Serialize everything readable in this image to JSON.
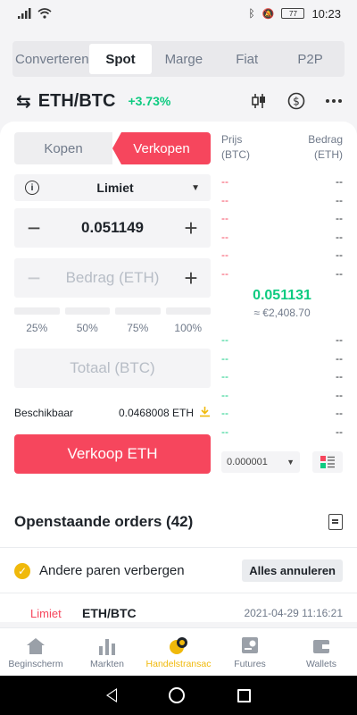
{
  "status_bar": {
    "time": "10:23",
    "battery": "77"
  },
  "top_tabs": [
    {
      "label": "Converteren",
      "active": false
    },
    {
      "label": "Spot",
      "active": true
    },
    {
      "label": "Marge",
      "active": false
    },
    {
      "label": "Fiat",
      "active": false
    },
    {
      "label": "P2P",
      "active": false
    }
  ],
  "pair": {
    "icon": "⇆",
    "name": "ETH/BTC",
    "change": "+3.73%"
  },
  "side_toggle": {
    "buy": "Kopen",
    "sell": "Verkopen"
  },
  "order_type": {
    "label": "Limiet"
  },
  "price_input": {
    "value": "0.051149"
  },
  "amount_input": {
    "placeholder": "Bedrag (ETH)"
  },
  "percentages": [
    "25%",
    "50%",
    "75%",
    "100%"
  ],
  "total_input": {
    "placeholder": "Totaal (BTC)"
  },
  "available": {
    "label": "Beschikbaar",
    "value": "0.0468008 ETH"
  },
  "sell_button": "Verkoop ETH",
  "order_book": {
    "price_header": [
      "Prijs",
      "(BTC)"
    ],
    "amount_header": [
      "Bedrag",
      "(ETH)"
    ],
    "asks": [
      {
        "price": "--",
        "amount": "--"
      },
      {
        "price": "--",
        "amount": "--"
      },
      {
        "price": "--",
        "amount": "--"
      },
      {
        "price": "--",
        "amount": "--"
      },
      {
        "price": "--",
        "amount": "--"
      },
      {
        "price": "--",
        "amount": "--"
      }
    ],
    "last_price": "0.051131",
    "fiat_price": "≈ €2,408.70",
    "bids": [
      {
        "price": "--",
        "amount": "--"
      },
      {
        "price": "--",
        "amount": "--"
      },
      {
        "price": "--",
        "amount": "--"
      },
      {
        "price": "--",
        "amount": "--"
      },
      {
        "price": "--",
        "amount": "--"
      },
      {
        "price": "--",
        "amount": "--"
      }
    ],
    "precision": "0.000001"
  },
  "open_orders": {
    "title": "Openstaande orders (42)",
    "hide_pairs": "Andere paren verbergen",
    "cancel_all": "Alles annuleren",
    "first_order": {
      "type": "Limiet",
      "pair": "ETH/BTC",
      "time": "2021-04-29 11:16:21"
    }
  },
  "bottom_nav": [
    {
      "label": "Beginscherm",
      "icon": "home-icon",
      "active": false
    },
    {
      "label": "Markten",
      "icon": "markets-icon",
      "active": false
    },
    {
      "label": "Handelstransac",
      "icon": "trade-icon",
      "active": true
    },
    {
      "label": "Futures",
      "icon": "futures-icon",
      "active": false
    },
    {
      "label": "Wallets",
      "icon": "wallet-icon",
      "active": false
    }
  ],
  "colors": {
    "red": "#f6465d",
    "green": "#0ecb81",
    "yellow": "#f0b90b"
  }
}
